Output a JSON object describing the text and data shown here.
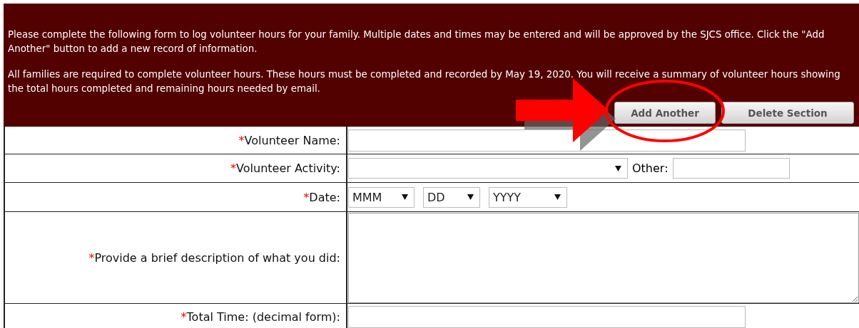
{
  "intro": [
    "Please complete the following form to log volunteer hours for your family. Multiple dates and times may be entered and will be approved by the SJCS office. Click the \"Add Another\" button to add a new record of information.",
    "All families are required to complete volunteer hours. These hours must be completed and recorded by May 19, 2020. You will receive a summary of volunteer hours showing the total hours completed and remaining hours needed by email."
  ],
  "buttons": [
    "Add Another",
    "Delete Section"
  ],
  "fields": [
    {
      "kind": "text",
      "mark": "*",
      "label": "Volunteer Name:"
    },
    {
      "kind": "activity",
      "mark": "*",
      "label": "Volunteer Activity:",
      "other_label": "Other:"
    },
    {
      "kind": "date",
      "mark": "*",
      "label": "Date:",
      "selects": [
        "MMM",
        "DD",
        "YYYY"
      ]
    },
    {
      "kind": "textarea",
      "mark": "*",
      "label": "Provide a brief description of what you did:"
    },
    {
      "kind": "text",
      "mark": "*",
      "label": "Total Time: (decimal form):"
    }
  ]
}
